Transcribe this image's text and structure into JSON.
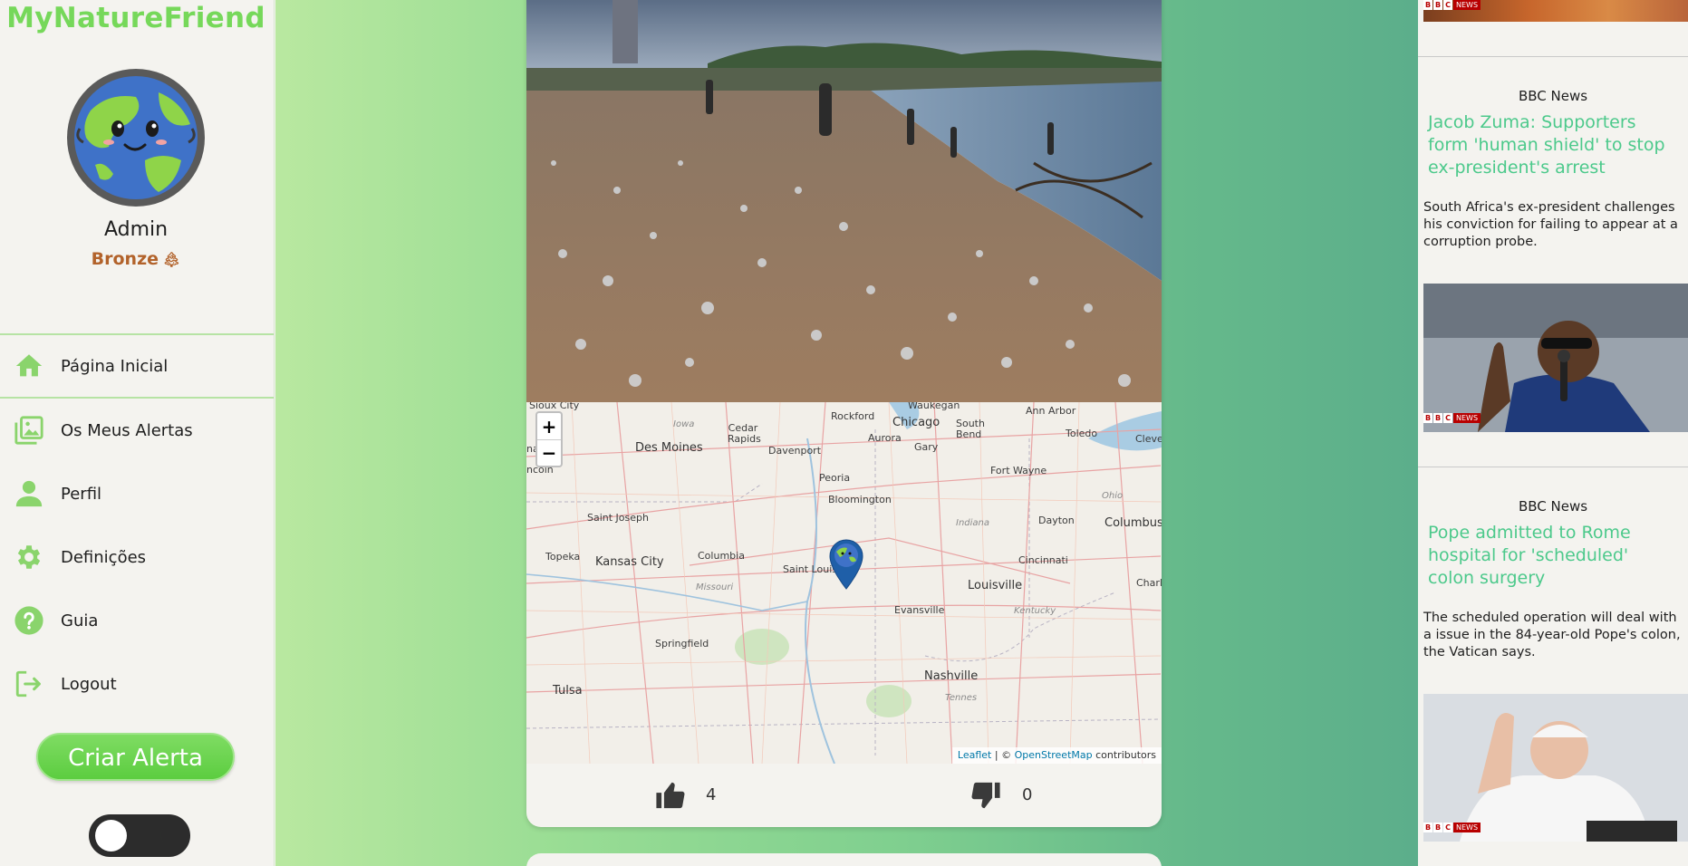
{
  "app": {
    "brand": "MyNatureFriend"
  },
  "user": {
    "name": "Admin",
    "rank": "Bronze",
    "rank_icon": "tree-icon"
  },
  "nav": {
    "items": [
      {
        "label": "Página Inicial",
        "icon": "home-icon",
        "active": true
      },
      {
        "label": "Os Meus Alertas",
        "icon": "gallery-icon",
        "active": false
      },
      {
        "label": "Perfil",
        "icon": "user-icon",
        "active": false
      },
      {
        "label": "Definições",
        "icon": "gear-icon",
        "active": false
      },
      {
        "label": "Guia",
        "icon": "help-icon",
        "active": false
      },
      {
        "label": "Logout",
        "icon": "logout-icon",
        "active": false
      }
    ]
  },
  "create_alert": {
    "label": "Criar Alerta"
  },
  "colors": {
    "accent": "#76d85a",
    "rank": "#b2622a",
    "news_title": "#4cc98b",
    "marker": "#1f5fa8"
  },
  "post": {
    "photo_icon": "beach-pollution-photo",
    "map": {
      "zoom_in": "+",
      "zoom_out": "−",
      "attribution": {
        "leaflet": "Leaflet",
        "separator": " | © ",
        "osm": "OpenStreetMap",
        "suffix": " contributors"
      },
      "labels": {
        "sioux_city": "Sioux City",
        "waukegan": "Waukegan",
        "ann_arbor": "Ann Arbor",
        "chicago": "Chicago",
        "rockford": "Rockford",
        "south_bend": "South Bend",
        "toledo": "Toledo",
        "cleveland": "Clevel",
        "omaha": "naha",
        "iowa": "Iowa",
        "cedar_rapids": "Cedar Rapids",
        "aurora": "Aurora",
        "gary": "Gary",
        "des_moines": "Des Moines",
        "davenport": "Davenport",
        "fort_wayne": "Fort Wayne",
        "lincoln": "ncoln",
        "peoria": "Peoria",
        "ohio": "Ohio",
        "bloomington": "Bloomington",
        "saint_joseph": "Saint Joseph",
        "indiana": "Indiana",
        "dayton": "Dayton",
        "columbus_oh": "Columbus",
        "topeka": "Topeka",
        "kansas_city": "Kansas City",
        "columbia": "Columbia",
        "saint_louis": "Saint Louis",
        "cincinnati": "Cincinnati",
        "charleston": "Charle",
        "missouri": "Missouri",
        "louisville": "Louisville",
        "evansville": "Evansville",
        "kentucky": "Kentucky",
        "springfield": "Springfield",
        "nashville": "Nashville",
        "tulsa": "Tulsa",
        "tennessee": "Tennes"
      }
    },
    "likes": 4,
    "dislikes": 0
  },
  "news": {
    "items": [
      {
        "source": "BBC News",
        "title": "Jacob Zuma: Supporters form 'human shield' to stop ex-president's arrest",
        "description": "South Africa's ex-president challenges his conviction for failing to appear at a corruption probe.",
        "image": "jacob-zuma-photo"
      },
      {
        "source": "BBC News",
        "title": "Pope admitted to Rome hospital for 'scheduled' colon surgery",
        "description": "The scheduled operation will deal with a issue in the 84-year-old Pope's colon, the Vatican says.",
        "image": "pope-photo"
      }
    ],
    "badge": {
      "letters": [
        "B",
        "B",
        "C"
      ],
      "word": "NEWS"
    }
  }
}
